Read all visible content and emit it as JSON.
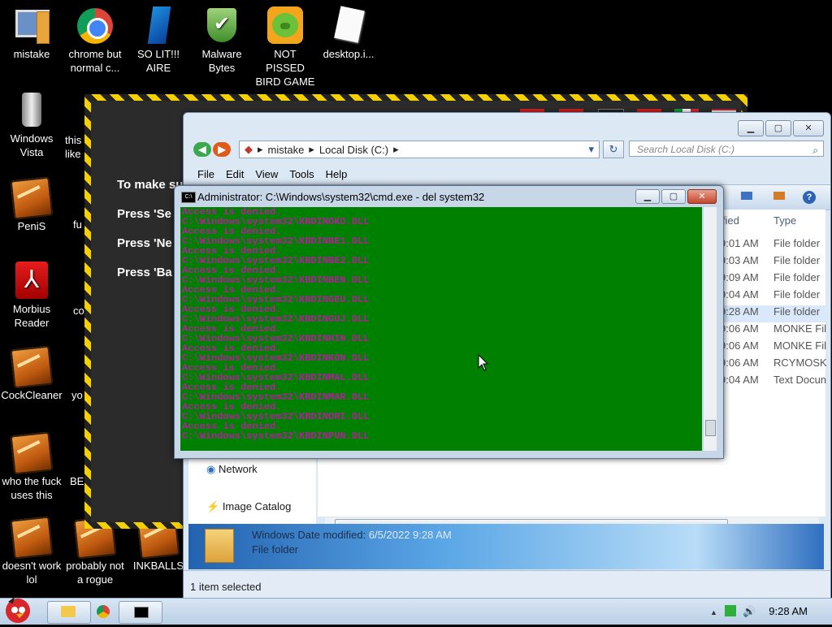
{
  "desktop": {
    "icons": [
      {
        "label": "mistake",
        "icon": "computer-icon"
      },
      {
        "label": "chrome but normal c...",
        "icon": "chrome-icon"
      },
      {
        "label": "SO LIT!!! AIRE",
        "icon": "blue-crystal-icon"
      },
      {
        "label": "Malware Bytes",
        "icon": "shield-check-icon"
      },
      {
        "label": "NOT PISSED BIRD GAME",
        "icon": "green-pig-icon"
      },
      {
        "label": "desktop.i...",
        "icon": "document-icon"
      },
      {
        "label": "Windows Vista",
        "icon": "recycle-bin-icon"
      },
      {
        "label": "this like",
        "icon": "file-icon"
      },
      {
        "label": "PeniS",
        "icon": "cockroach-icon"
      },
      {
        "label": "fu",
        "icon": "cockroach-icon"
      },
      {
        "label": "Morbius Reader",
        "icon": "pdf-reader-icon"
      },
      {
        "label": "co",
        "icon": "cockroach-icon"
      },
      {
        "label": "CockCleaner",
        "icon": "cockroach-icon"
      },
      {
        "label": "yo",
        "icon": "cockroach-icon"
      },
      {
        "label": "who the fuck uses this",
        "icon": "cockroach-icon"
      },
      {
        "label": "BE",
        "icon": "cockroach-icon"
      },
      {
        "label": "doesn't work lol",
        "icon": "cockroach-icon"
      },
      {
        "label": "probably not a rogue",
        "icon": "cockroach-icon"
      },
      {
        "label": "INKBALLS",
        "icon": "cockroach-icon"
      }
    ]
  },
  "tape_window": {
    "lines": [
      "To make su",
      "Press 'Se",
      "Press 'Ne",
      "Press 'Ba"
    ]
  },
  "explorer": {
    "breadcrumb": [
      "mistake",
      "Local Disk (C:)"
    ],
    "search_placeholder": "Search Local Disk (C:)",
    "menu": [
      "File",
      "Edit",
      "View",
      "Tools",
      "Help"
    ],
    "columns": {
      "modified": "ified",
      "type": "Type"
    },
    "rows": [
      {
        "time": "9:01 AM",
        "type": "File folder"
      },
      {
        "time": "9:03 AM",
        "type": "File folder"
      },
      {
        "time": "9:09 AM",
        "type": "File folder"
      },
      {
        "time": "9:04 AM",
        "type": "File folder"
      },
      {
        "time": "9:28 AM",
        "type": "File folder"
      },
      {
        "time": "9:06 AM",
        "type": "MONKE Fil"
      },
      {
        "time": "9:06 AM",
        "type": "MONKE Fil"
      },
      {
        "time": "9:06 AM",
        "type": "RCYMOSK"
      },
      {
        "time": "9:04 AM",
        "type": "Text Docun"
      }
    ],
    "nav": {
      "network": "Network",
      "image_catalog": "Image Catalog"
    },
    "details": {
      "name": "Windows",
      "modified_label": "Date modified:",
      "modified_value": "6/5/2022 9:28 AM",
      "kind": "File folder"
    },
    "status": "1 item selected"
  },
  "cmd": {
    "title": "Administrator: C:\\Windows\\system32\\cmd.exe - del  system32",
    "lines": [
      "Access is denied.",
      "C:\\Windows\\system32\\KBDINOKO.DLL",
      "Access is denied.",
      "C:\\Windows\\system32\\KBDINBE1.DLL",
      "Access is denied.",
      "C:\\Windows\\system32\\KBDINBE2.DLL",
      "Access is denied.",
      "C:\\Windows\\system32\\KBDINBEN.DLL",
      "Access is denied.",
      "C:\\Windows\\system32\\KBDINGEU.DLL",
      "Access is denied.",
      "C:\\Windows\\system32\\KBDINGUJ.DLL",
      "Access is denied.",
      "C:\\Windows\\system32\\KBDINHIN.DLL",
      "Access is denied.",
      "C:\\Windows\\system32\\KBDINKON.DLL",
      "Access is denied.",
      "C:\\Windows\\system32\\KBDINMAL.DLL",
      "Access is denied.",
      "C:\\Windows\\system32\\KBDINMAR.DLL",
      "Access is denied.",
      "C:\\Windows\\system32\\KBDINORI.DLL",
      "Access is denied.",
      "C:\\Windows\\system32\\KBDINPUN.DLL"
    ],
    "colors": {
      "background": "#008000",
      "text": "#b0209a"
    }
  },
  "taskbar": {
    "clock": "9:28 AM"
  }
}
